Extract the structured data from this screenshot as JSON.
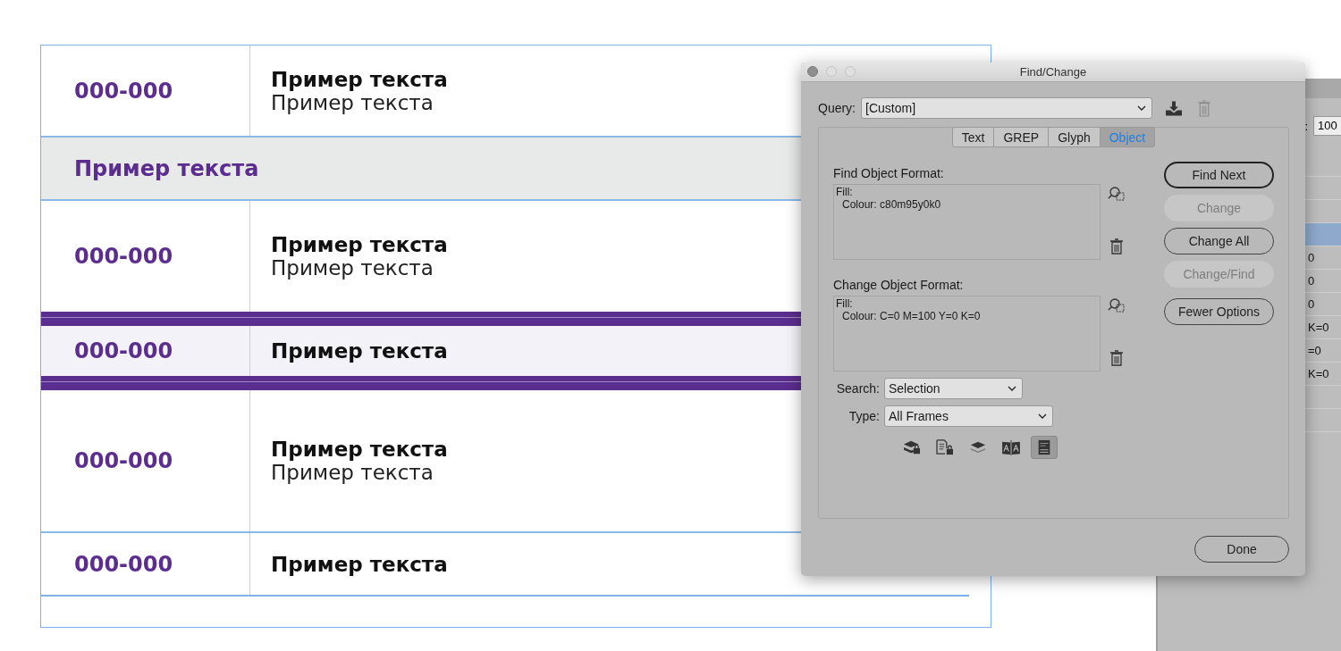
{
  "document": {
    "rows": [
      {
        "kind": "item",
        "number": "000-000",
        "title": "Пример текста",
        "subtitle": "Пример текста"
      },
      {
        "kind": "section",
        "title": "Пример текста"
      },
      {
        "kind": "item",
        "number": "000-000",
        "title": "Пример текста",
        "subtitle": "Пример текста"
      },
      {
        "kind": "highlight",
        "number": "000-000",
        "title": "Пример текста"
      },
      {
        "kind": "item",
        "number": "000-000",
        "title": "Пример текста",
        "subtitle": "Пример текста"
      },
      {
        "kind": "item",
        "number": "000-000",
        "title": "Пример текста"
      }
    ]
  },
  "back_panel": {
    "field_label": ":",
    "field_value": "100",
    "rows": [
      {
        "selected": false
      },
      {
        "selected": false
      },
      {
        "selected": false
      },
      {
        "selected": true
      },
      {
        "text": "0",
        "selected": false
      },
      {
        "text": "0",
        "selected": false
      },
      {
        "text": "0",
        "selected": false
      },
      {
        "text": "K=0",
        "selected": false
      },
      {
        "text": "=0",
        "selected": false
      },
      {
        "text": "K=0",
        "selected": false
      },
      {
        "selected": false
      },
      {
        "selected": false
      }
    ]
  },
  "dialog": {
    "title": "Find/Change",
    "query": {
      "label": "Query:",
      "value": "[Custom]"
    },
    "tabs": [
      {
        "label": "Text",
        "selected": false
      },
      {
        "label": "GREP",
        "selected": false
      },
      {
        "label": "Glyph",
        "selected": false
      },
      {
        "label": "Object",
        "selected": true
      }
    ],
    "find_format": {
      "label": "Find Object Format:",
      "lines": [
        "Fill:",
        "Colour: c80m95y0k0"
      ]
    },
    "change_format": {
      "label": "Change Object Format:",
      "lines": [
        "Fill:",
        "Colour: C=0 M=100 Y=0 K=0"
      ]
    },
    "search": {
      "label": "Search:",
      "value": "Selection"
    },
    "type": {
      "label": "Type:",
      "value": "All Frames"
    },
    "options": [
      {
        "kind": "locked-layers",
        "on": false
      },
      {
        "kind": "locked-items",
        "on": false
      },
      {
        "kind": "hidden-layers",
        "on": false
      },
      {
        "kind": "master-pages",
        "on": false
      },
      {
        "kind": "footnotes",
        "on": true
      }
    ],
    "buttons": [
      {
        "label": "Find Next",
        "default": true,
        "disabled": false
      },
      {
        "label": "Change",
        "default": false,
        "disabled": true
      },
      {
        "label": "Change All",
        "default": false,
        "disabled": false
      },
      {
        "label": "Change/Find",
        "default": false,
        "disabled": true
      },
      {
        "label": "Fewer Options",
        "default": false,
        "disabled": false
      }
    ],
    "done": "Done"
  }
}
